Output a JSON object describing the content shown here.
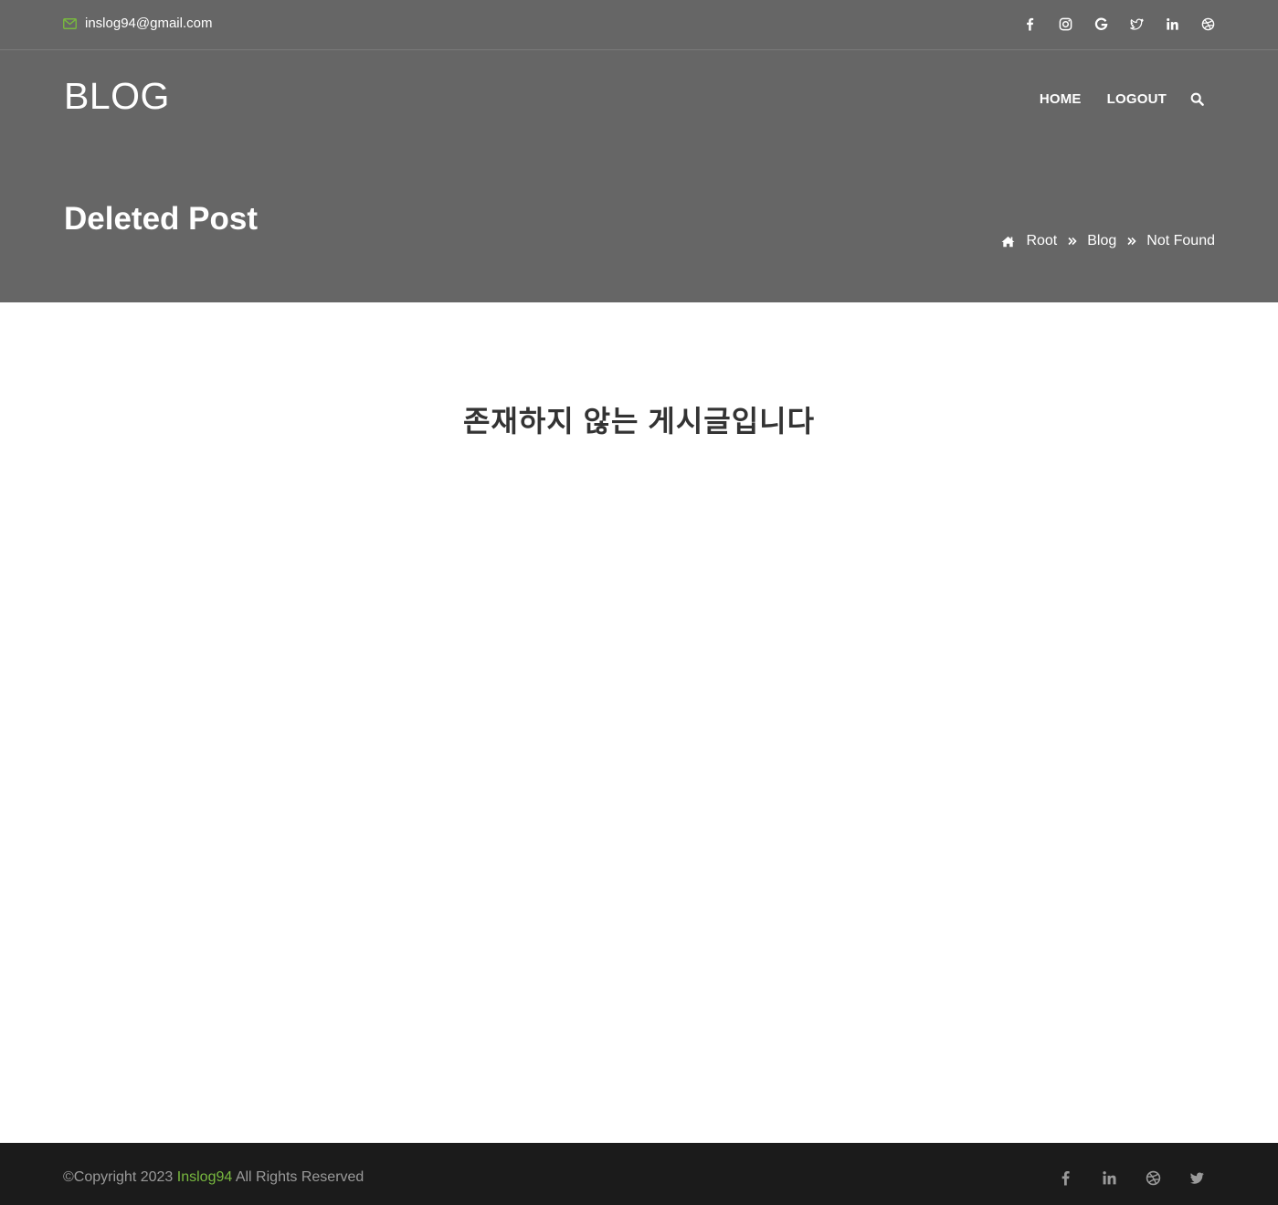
{
  "topbar": {
    "email": "inslog94@gmail.com",
    "email_icon": "envelope-icon",
    "social_icons": [
      "facebook-icon",
      "instagram-icon",
      "google-icon",
      "twitter-icon",
      "linkedin-icon",
      "dribbble-icon"
    ]
  },
  "header": {
    "logo": "BLOG",
    "nav": {
      "home": "HOME",
      "logout": "LOGOUT",
      "search_icon": "search-icon"
    }
  },
  "hero": {
    "title": "Deleted Post",
    "breadcrumb": {
      "home_icon": "home-icon",
      "items": [
        "Root",
        "Blog",
        "Not Found"
      ],
      "separator_icon": "double-chevron-right-icon"
    }
  },
  "main": {
    "message": "존재하지 않는 게시글입니다"
  },
  "footer": {
    "copyright_prefix": "©Copyright 2023",
    "brand": "Inslog94",
    "copyright_suffix": "All Rights Reserved",
    "social_icons": [
      "facebook-icon",
      "linkedin-icon",
      "dribbble-icon",
      "twitter-icon"
    ]
  },
  "colors": {
    "header_bg": "#666666",
    "footer_bg": "#1b1b1b",
    "accent_green": "#78b83f",
    "heading_text": "#333333",
    "footer_text": "#9a9a9a"
  }
}
